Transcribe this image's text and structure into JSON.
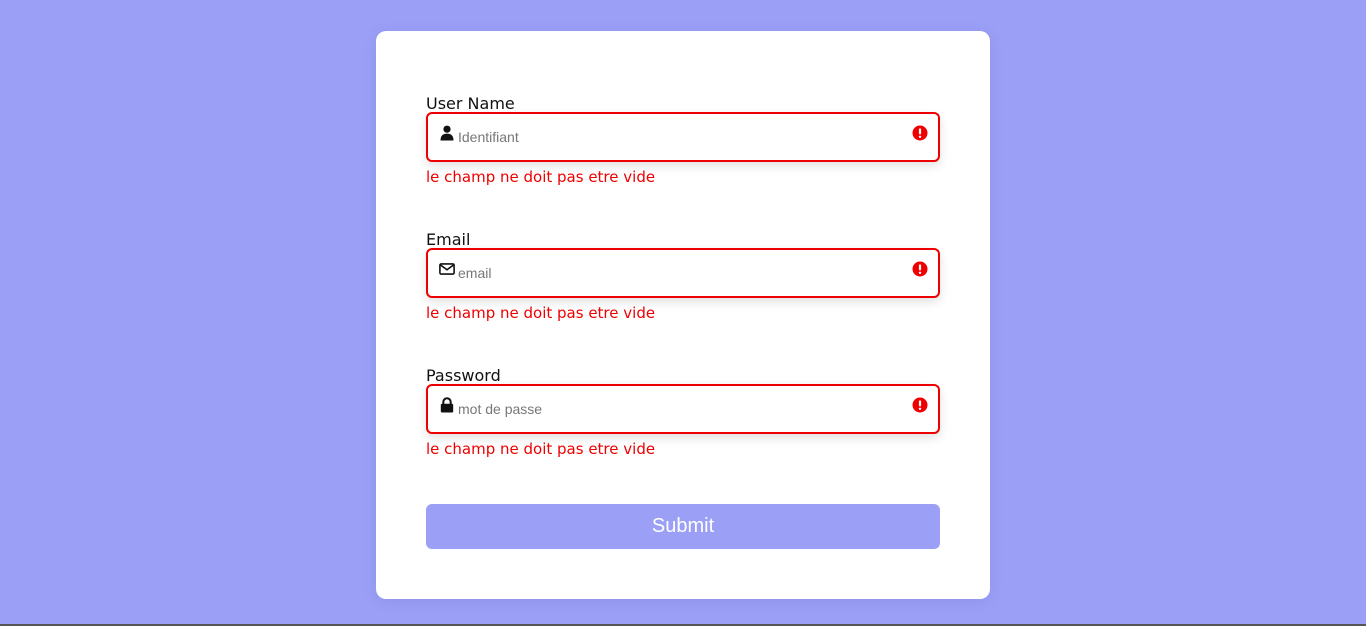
{
  "colors": {
    "background": "#9b9ff5",
    "card": "#ffffff",
    "error": "#ee0000",
    "button": "#9b9ff5",
    "button_text": "#ffffff"
  },
  "form": {
    "username": {
      "label": "User Name",
      "placeholder": "Identifiant",
      "value": "",
      "icon": "user-icon",
      "error": "le champ ne doit pas etre vide",
      "status_icon": "error-icon"
    },
    "email": {
      "label": "Email",
      "placeholder": "email",
      "value": "",
      "icon": "envelope-icon",
      "error": "le champ ne doit pas etre vide",
      "status_icon": "error-icon"
    },
    "password": {
      "label": "Password",
      "placeholder": "mot de passe",
      "value": "",
      "icon": "lock-icon",
      "error": "le champ ne doit pas etre vide",
      "status_icon": "error-icon"
    },
    "submit_label": "Submit"
  }
}
